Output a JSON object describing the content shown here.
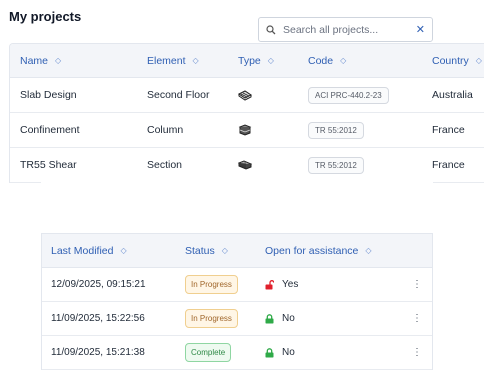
{
  "page": {
    "title": "My projects"
  },
  "projects_table": {
    "columns": [
      "Name",
      "Element",
      "Type",
      "Code",
      "Country"
    ],
    "rows": [
      {
        "name": "Slab Design",
        "element": "Second Floor",
        "type_icon": "slab-icon",
        "code": "ACI PRC-440.2-23",
        "country": "Australia"
      },
      {
        "name": "Confinement",
        "element": "Column",
        "type_icon": "column-icon",
        "code": "TR 55:2012",
        "country": "France"
      },
      {
        "name": "TR55 Shear",
        "element": "Section",
        "type_icon": "section-icon",
        "code": "TR 55:2012",
        "country": "France"
      }
    ]
  },
  "search": {
    "placeholder": "Search all projects..."
  },
  "details_table": {
    "columns": [
      "Last Modified",
      "Status",
      "Open for assistance"
    ],
    "rows": [
      {
        "last_modified": "12/09/2025, 09:15:21",
        "status": "In Progress",
        "status_kind": "progress",
        "assistance": "Yes",
        "lock_icon": "unlocked-icon",
        "lock_color": "#e0202c"
      },
      {
        "last_modified": "11/09/2025, 15:22:56",
        "status": "In Progress",
        "status_kind": "progress",
        "assistance": "No",
        "lock_icon": "locked-icon",
        "lock_color": "#2faa48"
      },
      {
        "last_modified": "11/09/2025, 15:21:38",
        "status": "Complete",
        "status_kind": "complete",
        "assistance": "No",
        "lock_icon": "locked-icon",
        "lock_color": "#2faa48"
      }
    ]
  },
  "colors": {
    "accent": "#2f5fb3",
    "header_bg": "#f3f5f9",
    "border": "#e3e7ee"
  }
}
